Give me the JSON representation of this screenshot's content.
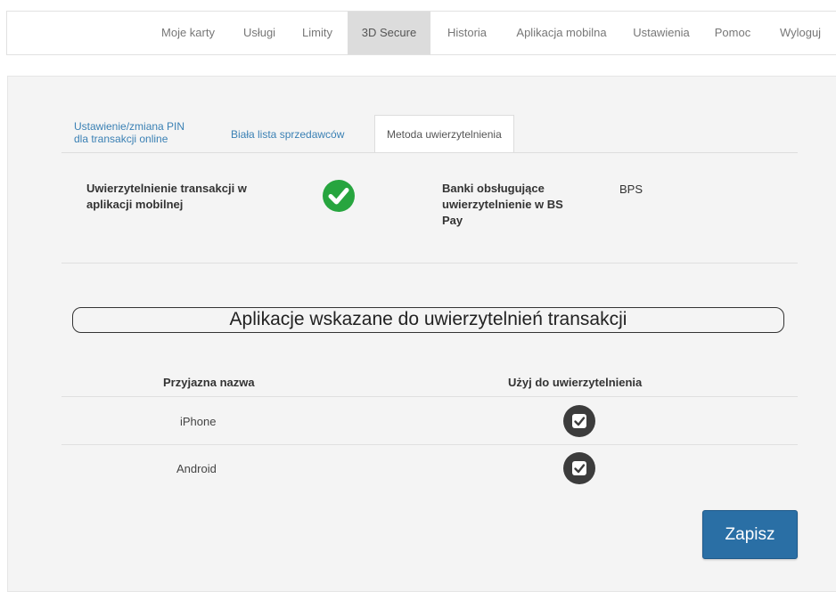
{
  "nav": {
    "items": [
      {
        "label": "Moje karty",
        "active": false
      },
      {
        "label": "Usługi",
        "active": false
      },
      {
        "label": "Limity",
        "active": false
      },
      {
        "label": "3D Secure",
        "active": true
      },
      {
        "label": "Historia",
        "active": false
      },
      {
        "label": "Aplikacja mobilna",
        "active": false
      },
      {
        "label": "Ustawienia",
        "active": false
      },
      {
        "label": "Pomoc",
        "active": false
      },
      {
        "label": "Wyloguj",
        "active": false
      }
    ]
  },
  "tabs": {
    "pin_line1": "Ustawienie/zmiana PIN",
    "pin_line2": "dla transakcji online",
    "whitelist": "Biała lista sprzedawców",
    "method": "Metoda uwierzytelnienia"
  },
  "info": {
    "mobile_auth_line1": "Uwierzytelnienie transakcji w",
    "mobile_auth_line2": "aplikacji mobilnej",
    "mobile_auth_enabled": true,
    "banks_line1": "Banki obsługujące",
    "banks_line2": "uwierzytelnienie w BS",
    "banks_line3": "Pay",
    "banks_value": "BPS"
  },
  "apps_section": {
    "title": "Aplikacje wskazane do uwierzytelnień transakcji",
    "col_name": "Przyjazna nazwa",
    "col_use": "Użyj do uwierzytelnienia",
    "rows": [
      {
        "name": "iPhone",
        "use": true
      },
      {
        "name": "Android",
        "use": true
      }
    ]
  },
  "save_label": "Zapisz",
  "colors": {
    "link": "#3a80b4",
    "check_green": "#27a53f",
    "button_blue": "#2a6fa5"
  }
}
